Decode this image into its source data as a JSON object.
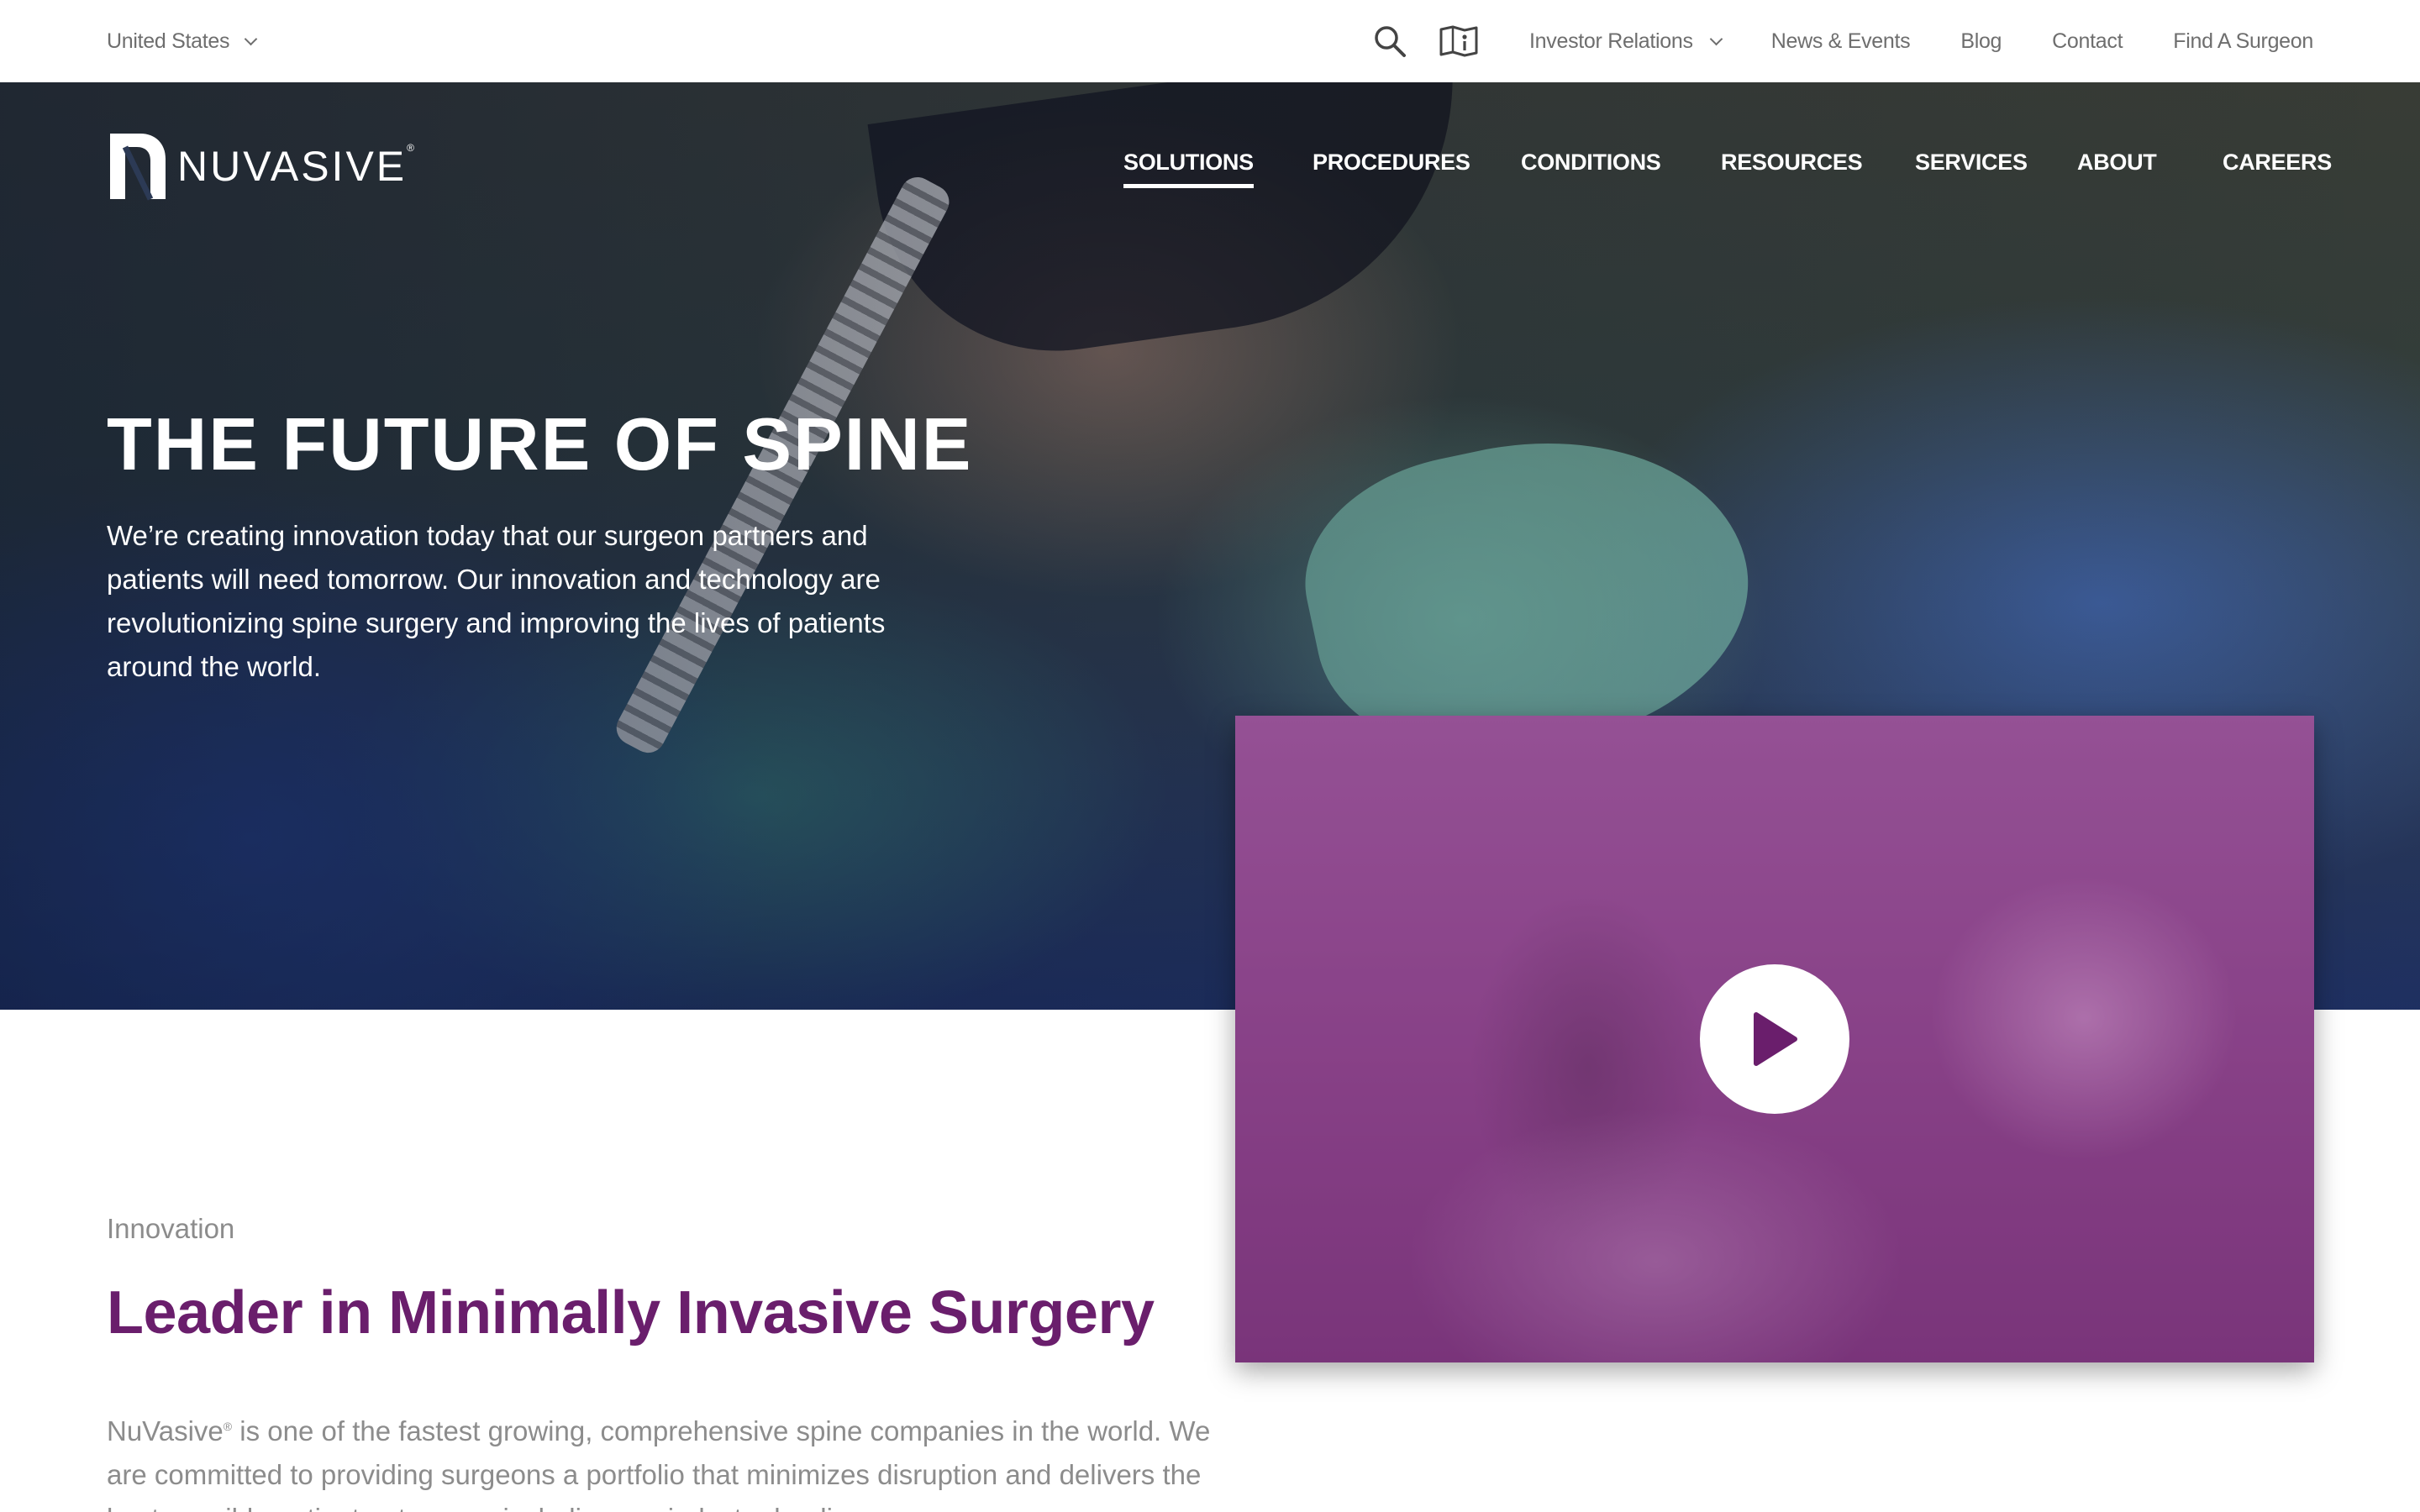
{
  "utility_bar": {
    "region": "United States",
    "links": {
      "investor_relations": "Investor Relations",
      "news_events": "News & Events",
      "blog": "Blog",
      "contact": "Contact",
      "find_surgeon": "Find A Surgeon"
    },
    "icons": [
      "search-icon",
      "map-info-icon"
    ]
  },
  "brand": {
    "logo_text": "NUVASIVE",
    "registered_mark": "®"
  },
  "main_nav": {
    "solutions": "SOLUTIONS",
    "procedures": "PROCEDURES",
    "conditions": "CONDITIONS",
    "resources": "RESOURCES",
    "services": "SERVICES",
    "about": "ABOUT",
    "careers": "CAREERS",
    "active": "SOLUTIONS"
  },
  "hero": {
    "title": "THE FUTURE OF SPINE",
    "description": "We’re creating innovation today that our surgeon partners and patients will need tomorrow. Our innovation and technology are revolutionizing spine surgery and improving the lives of patients around the world."
  },
  "video": {
    "play_icon": "play-icon"
  },
  "innovation": {
    "eyebrow": "Innovation",
    "title": "Leader in Minimally Invasive Surgery",
    "brand_name": "NuVasive",
    "registered_mark": "®",
    "body": "is one of the fastest growing, comprehensive spine companies in the world. We are committed to providing surgeons a portfolio that minimizes disruption and delivers the best possible patient outcomes, including our industry-leading"
  },
  "colors": {
    "brand_purple": "#6a1e6c",
    "video_purple": "#8f4a8e",
    "utility_text": "#6e6e6e",
    "body_gray": "#8c8c8c"
  }
}
